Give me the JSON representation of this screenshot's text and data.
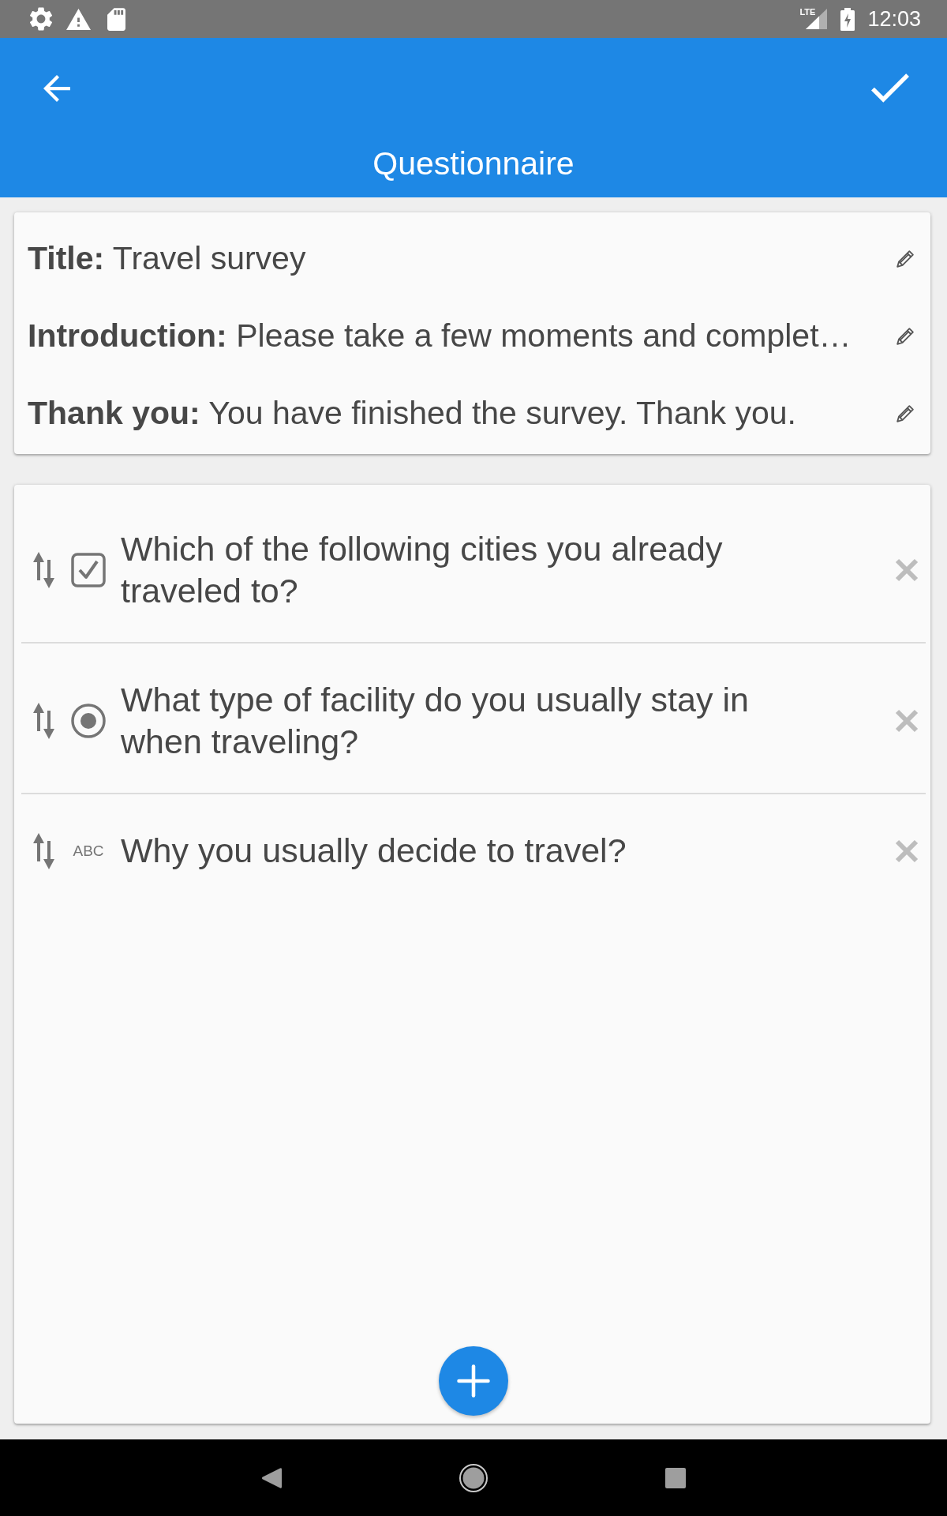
{
  "status_bar": {
    "network": "LTE",
    "time": "12:03"
  },
  "app_bar": {
    "title": "Questionnaire"
  },
  "details": [
    {
      "text": "**Title:** Travel survey"
    },
    {
      "text": "**Introduction:** Please take a few moments and complet…"
    },
    {
      "text": "**Thank you:** You have finished the survey. Thank you."
    }
  ],
  "questions": [
    {
      "kind": "checkbox",
      "text": "Which of the following cities you already traveled to?"
    },
    {
      "kind": "radio",
      "text": "What type of facility do you usually stay in when traveling?"
    },
    {
      "kind": "free_text",
      "type_label": "ABC",
      "text": "Why you usually decide to travel?"
    }
  ]
}
